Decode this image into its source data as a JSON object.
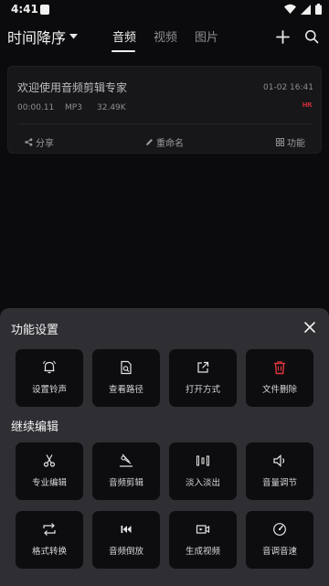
{
  "status_bar": {
    "time": "4:41"
  },
  "top_bar": {
    "sort_label": "时间降序",
    "tabs": [
      {
        "label": "音频",
        "active": true
      },
      {
        "label": "视频",
        "active": false
      },
      {
        "label": "图片",
        "active": false
      }
    ]
  },
  "file_card": {
    "name": "欢迎使用音频剪辑专家",
    "date": "01-02 16:41",
    "duration": "00:00.11",
    "format": "MP3",
    "size": "32.49K",
    "badge": "HR",
    "actions": {
      "share": "分享",
      "rename": "重命名",
      "function": "功能"
    }
  },
  "sheet": {
    "title": "功能设置",
    "settings": [
      {
        "label": "设置铃声",
        "icon": "bell-icon"
      },
      {
        "label": "查看路径",
        "icon": "file-search-icon"
      },
      {
        "label": "打开方式",
        "icon": "external-link-icon"
      },
      {
        "label": "文件删除",
        "icon": "trash-icon"
      }
    ],
    "edit_title": "继续编辑",
    "edit_tools": [
      {
        "label": "专业编辑",
        "icon": "scissors-icon"
      },
      {
        "label": "音频剪辑",
        "icon": "audio-cut-icon"
      },
      {
        "label": "淡入淡出",
        "icon": "fade-bars-icon"
      },
      {
        "label": "音量调节",
        "icon": "volume-icon"
      },
      {
        "label": "格式转换",
        "icon": "convert-icon"
      },
      {
        "label": "音频倒放",
        "icon": "rewind-icon"
      },
      {
        "label": "生成视频",
        "icon": "video-icon"
      },
      {
        "label": "音调音速",
        "icon": "speed-icon"
      }
    ]
  },
  "colors": {
    "accent_red": "#e0373f",
    "sheet_bg": "#2e2e33",
    "tile_bg": "#0d0d10"
  }
}
